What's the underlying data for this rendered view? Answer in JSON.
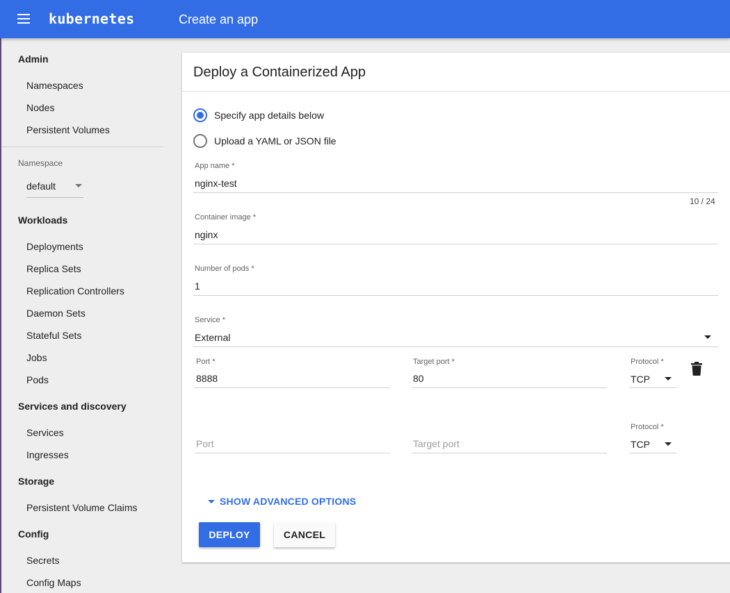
{
  "header": {
    "brand": "kubernetes",
    "title": "Create an app",
    "menu_icon": "hamburger-menu-icon",
    "bar_color": "#326de6"
  },
  "sidebar": {
    "admin": {
      "heading": "Admin",
      "items": [
        "Namespaces",
        "Nodes",
        "Persistent Volumes"
      ]
    },
    "namespace": {
      "label": "Namespace",
      "selected": "default"
    },
    "workloads": {
      "heading": "Workloads",
      "items": [
        "Deployments",
        "Replica Sets",
        "Replication Controllers",
        "Daemon Sets",
        "Stateful Sets",
        "Jobs",
        "Pods"
      ]
    },
    "services": {
      "heading": "Services and discovery",
      "items": [
        "Services",
        "Ingresses"
      ]
    },
    "storage": {
      "heading": "Storage",
      "items": [
        "Persistent Volume Claims"
      ]
    },
    "config": {
      "heading": "Config",
      "items": [
        "Secrets",
        "Config Maps"
      ]
    }
  },
  "form": {
    "title": "Deploy a Containerized App",
    "mode_options": [
      {
        "label": "Specify app details below",
        "selected": true
      },
      {
        "label": "Upload a YAML or JSON file",
        "selected": false
      }
    ],
    "app_name": {
      "label": "App name *",
      "value": "nginx-test",
      "counter": "10 / 24"
    },
    "container_image": {
      "label": "Container image *",
      "value": "nginx"
    },
    "pods": {
      "label": "Number of pods *",
      "value": "1"
    },
    "service": {
      "label": "Service *",
      "value": "External"
    },
    "port_rows": [
      {
        "port_label": "Port *",
        "port_value": "8888",
        "target_label": "Target port *",
        "target_value": "80",
        "protocol_label": "Protocol *",
        "protocol_value": "TCP"
      },
      {
        "port_placeholder": "Port",
        "target_placeholder": "Target port",
        "protocol_label": "Protocol *",
        "protocol_value": "TCP"
      }
    ],
    "delete_icon": "trash-icon",
    "advanced_label": "SHOW ADVANCED OPTIONS",
    "deploy_label": "DEPLOY",
    "cancel_label": "CANCEL"
  }
}
